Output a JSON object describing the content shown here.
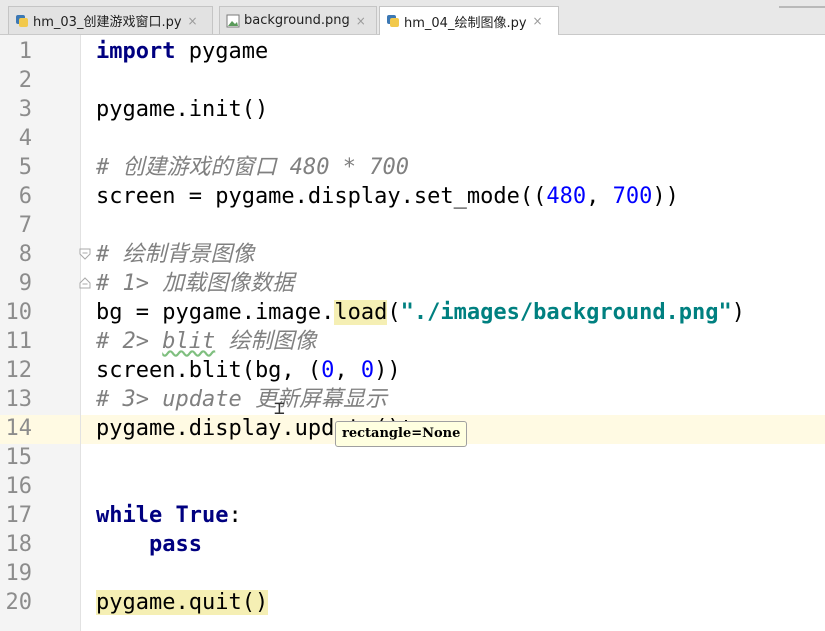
{
  "tabs": [
    {
      "label": "hm_03_创建游戏窗口.py",
      "close": "×",
      "icon": "python-file-icon"
    },
    {
      "label": "background.png",
      "close": "×",
      "icon": "image-file-icon"
    },
    {
      "label": "hm_04_绘制图像.py",
      "close": "×",
      "icon": "python-file-icon"
    }
  ],
  "active_tab": 2,
  "line_numbers": [
    "1",
    "2",
    "3",
    "4",
    "5",
    "6",
    "7",
    "8",
    "9",
    "10",
    "11",
    "12",
    "13",
    "14",
    "15",
    "16",
    "17",
    "18",
    "19",
    "20"
  ],
  "code": {
    "l1": {
      "kw": "import",
      "rest": " pygame"
    },
    "l3": "pygame.init()",
    "l5": "# 创建游戏的窗口 480 * 700",
    "l6": {
      "a": "screen = pygame.display.set_mode((",
      "n1": "480",
      "b": ", ",
      "n2": "700",
      "c": "))"
    },
    "l8": "# 绘制背景图像",
    "l9": "# 1> 加载图像数据",
    "l10": {
      "a": "bg = pygame.image.",
      "fn": "load",
      "b": "(",
      "s": "\"./images/background.png\"",
      "c": ")"
    },
    "l11": {
      "a": "# 2> ",
      "w": "blit",
      "b": " 绘制图像"
    },
    "l12": {
      "a": "screen.blit(bg, (",
      "n1": "0",
      "b": ", ",
      "n2": "0",
      "c": "))"
    },
    "l13": "# 3> update 更新屏幕显示",
    "l14": "pygame.display.update()",
    "l16": {
      "kw1": "while",
      "sp": " ",
      "kw2": "True",
      "c": ":"
    },
    "l17": {
      "indent": "    ",
      "kw": "pass"
    },
    "l19": "pygame.quit()"
  },
  "tooltip": "rectangle=None",
  "colors": {
    "keyword": "#000080",
    "number": "#0000ff",
    "string": "#008080",
    "comment": "#808080",
    "caret_row": "#fffae3"
  }
}
